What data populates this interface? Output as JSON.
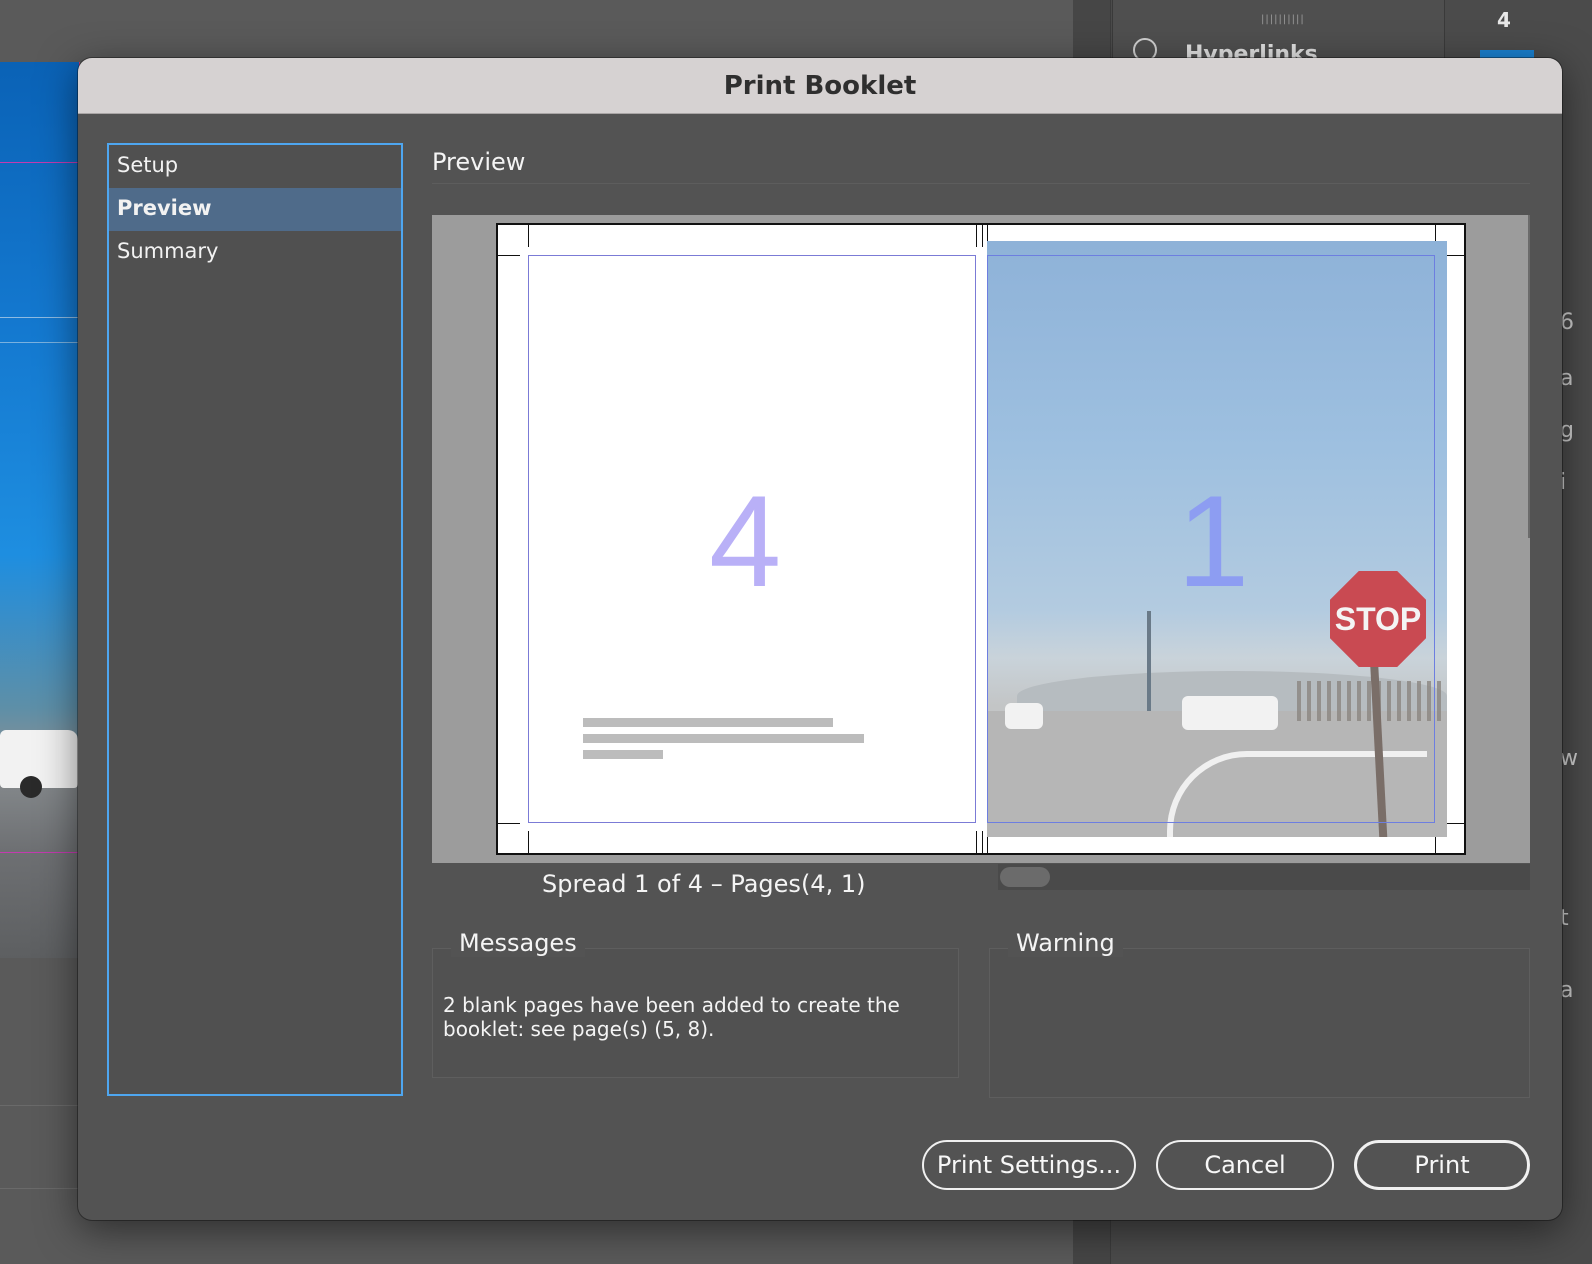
{
  "background": {
    "hyperlinks_panel_label": "Hyperlinks",
    "page_number": "4",
    "edge_letters": [
      "6",
      "a",
      "g",
      "i",
      "w",
      "t",
      "a"
    ]
  },
  "dialog": {
    "title": "Print Booklet",
    "nav": {
      "items": [
        {
          "label": "Setup",
          "active": false
        },
        {
          "label": "Preview",
          "active": true
        },
        {
          "label": "Summary",
          "active": false
        }
      ]
    },
    "section_title": "Preview",
    "preview": {
      "left_page_number": "4",
      "right_page_number": "1",
      "stop_sign_text": "STOP",
      "spread_label": "Spread 1 of 4 – Pages(4, 1)"
    },
    "messages": {
      "title": "Messages",
      "text": "2 blank pages have been added to create the booklet: see page(s) (5, 8)."
    },
    "warning": {
      "title": "Warning",
      "text": ""
    },
    "buttons": {
      "print_settings": "Print Settings...",
      "cancel": "Cancel",
      "print": "Print"
    }
  },
  "colors": {
    "accent_focus": "#4ea6f0",
    "nav_active": "#4f6b8a",
    "dialog_bg": "#535353",
    "titlebar_bg": "#d6d2d2"
  }
}
